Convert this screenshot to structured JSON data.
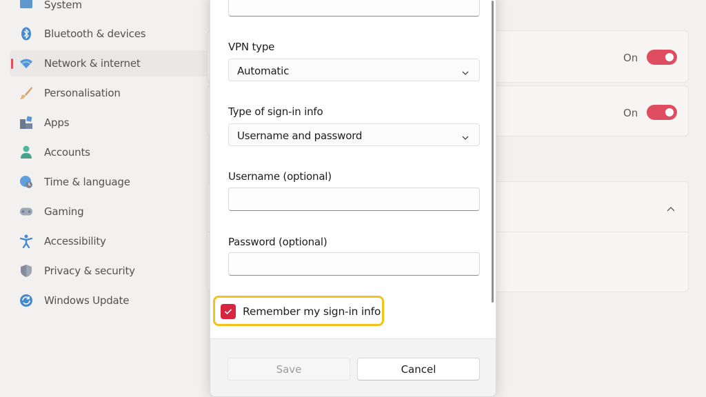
{
  "sidebar": {
    "items": [
      {
        "label": "System",
        "icon": "monitor-icon"
      },
      {
        "label": "Bluetooth & devices",
        "icon": "bluetooth-icon"
      },
      {
        "label": "Network & internet",
        "icon": "wifi-icon",
        "active": true
      },
      {
        "label": "Personalisation",
        "icon": "paintbrush-icon"
      },
      {
        "label": "Apps",
        "icon": "apps-icon"
      },
      {
        "label": "Accounts",
        "icon": "person-icon"
      },
      {
        "label": "Time & language",
        "icon": "globe-clock-icon"
      },
      {
        "label": "Gaming",
        "icon": "gamepad-icon"
      },
      {
        "label": "Accessibility",
        "icon": "accessibility-icon"
      },
      {
        "label": "Privacy & security",
        "icon": "shield-icon"
      },
      {
        "label": "Windows Update",
        "icon": "refresh-icon"
      }
    ]
  },
  "background": {
    "toggle1": {
      "label": "On",
      "state": true
    },
    "toggle2": {
      "label": "On",
      "state": true
    }
  },
  "dialog": {
    "vpn_type": {
      "label": "VPN type",
      "value": "Automatic"
    },
    "signin_type": {
      "label": "Type of sign-in info",
      "value": "Username and password"
    },
    "username": {
      "label": "Username (optional)",
      "value": ""
    },
    "password": {
      "label": "Password (optional)",
      "value": ""
    },
    "remember": {
      "label": "Remember my sign-in info",
      "checked": true
    },
    "save_label": "Save",
    "cancel_label": "Cancel"
  },
  "colors": {
    "accent": "#d7263d",
    "highlight": "#f1c21b"
  }
}
